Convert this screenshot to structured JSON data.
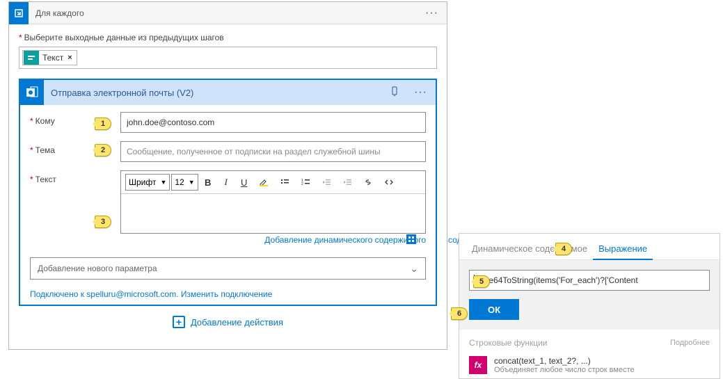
{
  "outer": {
    "title": "Для каждого",
    "menu_glyph": "···"
  },
  "inputs_section": {
    "label": "Выберите выходные данные из предыдущих шагов",
    "chip": {
      "label": "Текст",
      "x": "×"
    }
  },
  "action": {
    "title": "Отправка электронной почты (V2)",
    "menu_glyph": "···",
    "rows": {
      "to": {
        "label": "Кому",
        "value": "john.doe@contoso.com"
      },
      "subject": {
        "label": "Тема",
        "placeholder": "Сообщение, полученное от подписки на раздел служебной шины"
      },
      "body": {
        "label": "Текст"
      }
    },
    "rte": {
      "font_label": "Шрифт",
      "size_label": "12"
    },
    "add_dynamic": "Добавление динамического содержимого",
    "param_placeholder": "Добавление нового параметра",
    "connected": "Подключено к spelluru@microsoft.com. Изменить подключение"
  },
  "add_action": "Добавление действия",
  "callouts": {
    "c1": "1",
    "c2": "2",
    "c3": "3",
    "c4": "4",
    "c5": "5",
    "c6": "6"
  },
  "panel": {
    "tab_dynamic": "Динамическое содержимое",
    "tab_expression": "Выражение",
    "expression_value": "base64ToString(items('For_each')?['Content",
    "ok": "ОК",
    "section_string": "Строковые функции",
    "more": "Подробнее",
    "fx_glyph": "fx",
    "concat_title": "concat(text_1, text_2?, ...)",
    "concat_desc": "Объединяет любое число строк вместе"
  },
  "link_ext": "содержимого"
}
